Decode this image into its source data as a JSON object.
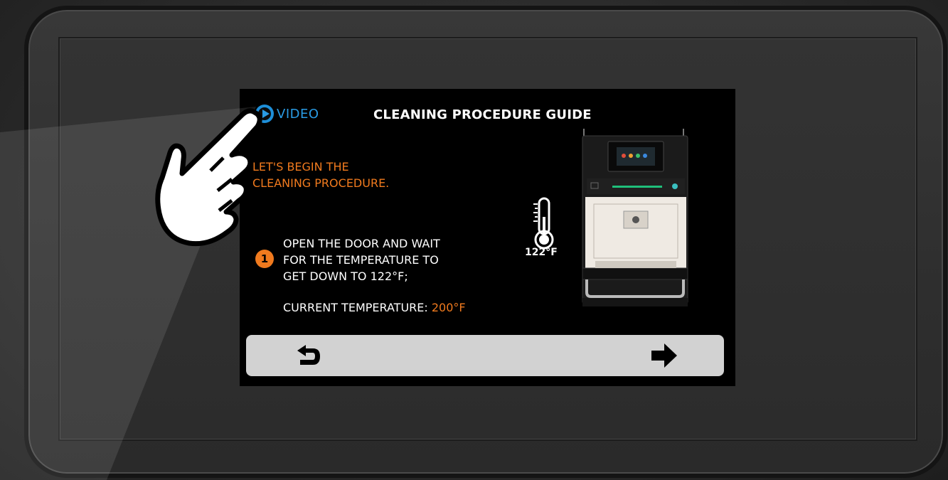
{
  "header": {
    "video_label": "VIDEO",
    "title": "CLEANING PROCEDURE GUIDE"
  },
  "intro": {
    "line1": "LET'S BEGIN THE",
    "line2": "CLEANING PROCEDURE."
  },
  "step": {
    "number": "1",
    "line1": "OPEN THE DOOR AND WAIT",
    "line2": "FOR THE TEMPERATURE TO",
    "line3": "GET DOWN TO 122°F;"
  },
  "current_temperature": {
    "label": "CURRENT TEMPERATURE:",
    "value": "200°F"
  },
  "thermometer": {
    "value": "122°F"
  },
  "icons": {
    "video": "play-circle-icon",
    "back": "undo-arrow-icon",
    "next": "right-arrow-icon",
    "thermometer": "thermometer-icon",
    "pointer": "pointing-hand-icon"
  },
  "colors": {
    "accent_orange": "#f07a1e",
    "accent_blue": "#2a9be4",
    "nav_bar": "#d2d2d2",
    "screen_bg": "#000000"
  }
}
